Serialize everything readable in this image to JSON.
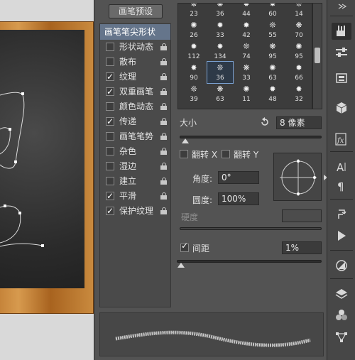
{
  "preset_button": "画笔预设",
  "options": {
    "header": "画笔笔尖形状",
    "items": [
      {
        "label": "形状动态",
        "checked": false
      },
      {
        "label": "散布",
        "checked": false
      },
      {
        "label": "纹理",
        "checked": true
      },
      {
        "label": "双重画笔",
        "checked": true
      },
      {
        "label": "颜色动态",
        "checked": false
      },
      {
        "label": "传递",
        "checked": true
      },
      {
        "label": "画笔笔势",
        "checked": false
      },
      {
        "label": "杂色",
        "checked": false
      },
      {
        "label": "湿边",
        "checked": false
      },
      {
        "label": "建立",
        "checked": false
      },
      {
        "label": "平滑",
        "checked": true
      },
      {
        "label": "保护纹理",
        "checked": true
      }
    ]
  },
  "brushes": {
    "rows": [
      [
        "23",
        "36",
        "44",
        "60",
        "14"
      ],
      [
        "26",
        "33",
        "42",
        "55",
        "70"
      ],
      [
        "112",
        "134",
        "74",
        "95",
        "95"
      ],
      [
        "90",
        "36",
        "33",
        "63",
        "66"
      ],
      [
        "39",
        "63",
        "11",
        "48",
        "32"
      ]
    ],
    "selected": "36"
  },
  "size": {
    "label": "大小",
    "value": "8 像素"
  },
  "flip_x": {
    "label": "翻转 X",
    "checked": false
  },
  "flip_y": {
    "label": "翻转 Y",
    "checked": false
  },
  "angle": {
    "label": "角度:",
    "value": "0°"
  },
  "roundness": {
    "label": "圆度:",
    "value": "100%"
  },
  "hardness": {
    "label": "硬度"
  },
  "spacing": {
    "label": "间距",
    "checked": true,
    "value": "1%"
  },
  "toolbar": {
    "icons": [
      "collapse-arrows-icon",
      "brush-icon",
      "sliders-icon",
      "character-icon",
      "cube-icon",
      "fx-icon",
      "type-icon",
      "paragraph-icon",
      "clone-source-icon",
      "play-icon",
      "adjust-icon",
      "layers-icon",
      "channels-icon",
      "paths-icon"
    ]
  }
}
